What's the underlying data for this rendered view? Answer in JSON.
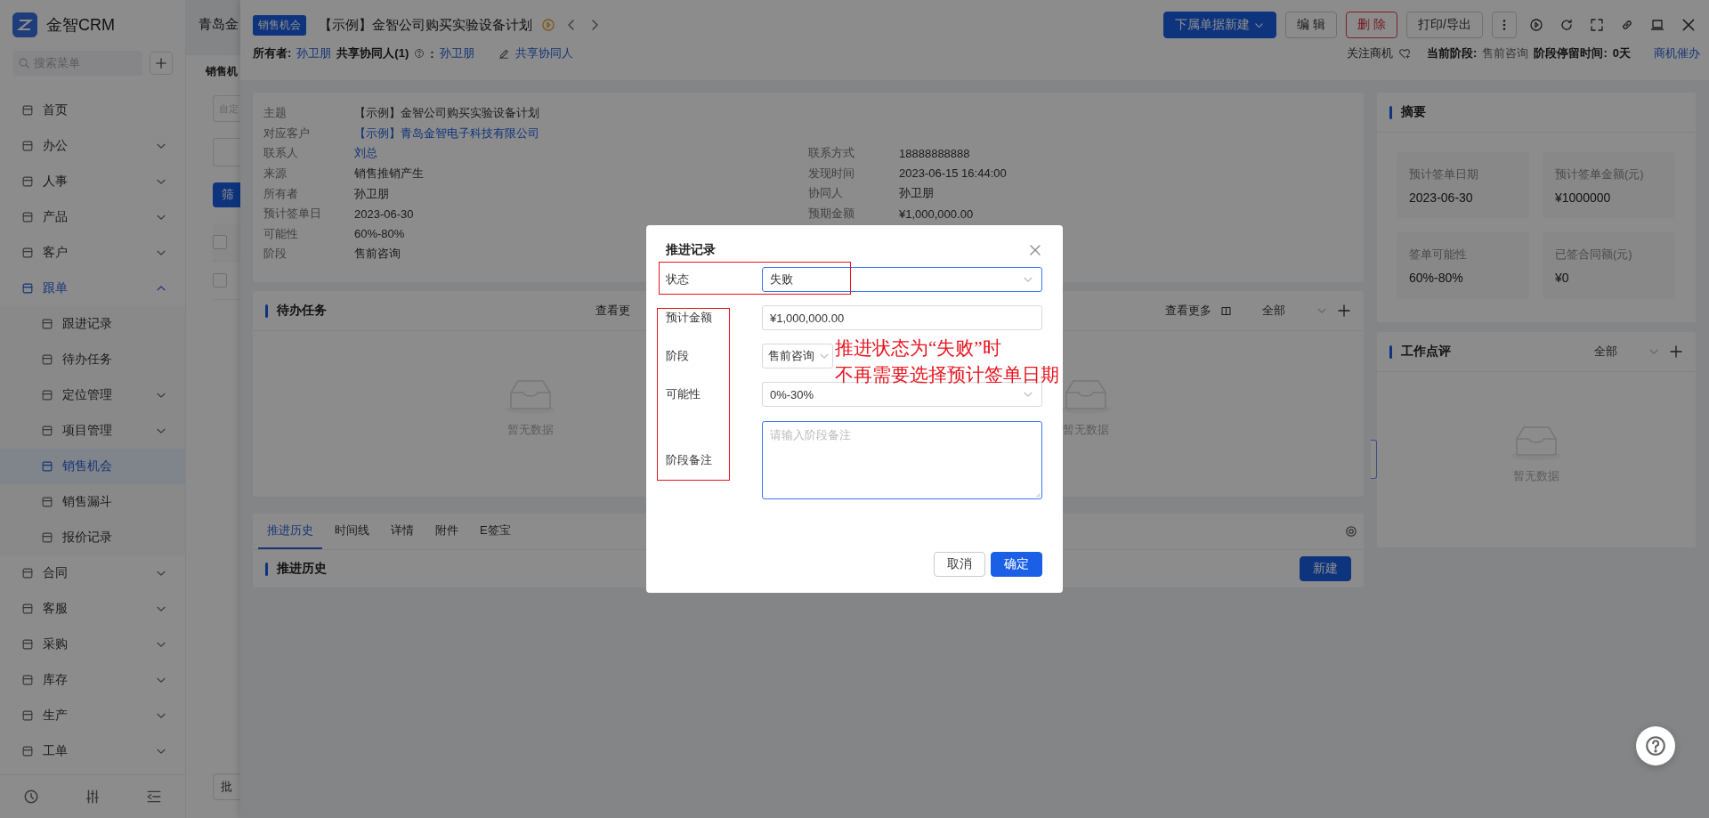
{
  "sidebar": {
    "brand": "金智CRM",
    "search": {
      "placeholder": "搜索菜单"
    },
    "items": [
      {
        "label": "首页",
        "selected": false
      },
      {
        "label": "办公",
        "selected": false,
        "expanded": false
      },
      {
        "label": "人事",
        "selected": false,
        "expanded": false
      },
      {
        "label": "产品",
        "selected": false,
        "expanded": false
      },
      {
        "label": "客户",
        "selected": false,
        "expanded": false
      },
      {
        "label": "跟单",
        "selected": true,
        "expanded": true,
        "children": [
          {
            "label": "跟进记录",
            "selected": false
          },
          {
            "label": "待办任务",
            "selected": false
          },
          {
            "label": "定位管理",
            "selected": false,
            "expanded": false
          },
          {
            "label": "项目管理",
            "selected": false,
            "expanded": false
          },
          {
            "label": "销售机会",
            "selected": true
          },
          {
            "label": "销售漏斗",
            "selected": false
          },
          {
            "label": "报价记录",
            "selected": false
          }
        ]
      },
      {
        "label": "合同",
        "selected": false,
        "expanded": false
      },
      {
        "label": "客服",
        "selected": false,
        "expanded": false
      },
      {
        "label": "采购",
        "selected": false,
        "expanded": false
      },
      {
        "label": "库存",
        "selected": false,
        "expanded": false
      },
      {
        "label": "生产",
        "selected": false,
        "expanded": false
      },
      {
        "label": "工单",
        "selected": false,
        "expanded": false
      }
    ]
  },
  "background_page": {
    "title": "青岛金",
    "tab": "销售机",
    "filter": {
      "placeholder": "自定"
    },
    "filter_button": "筛",
    "rows": [
      {
        "checked": false
      },
      {
        "checked": false
      }
    ],
    "batch_button": "批"
  },
  "record": {
    "tag": "销售机会",
    "title": "【示例】金智公司购买实验设备计划",
    "actions": [
      {
        "label": "下属单据新建",
        "kind": "primary"
      },
      {
        "label": "编 辑",
        "kind": "default"
      },
      {
        "label": "删 除",
        "kind": "danger"
      },
      {
        "label": "打印/导出",
        "kind": "default"
      }
    ],
    "owner": {
      "label": "所有者:",
      "value": "孙卫朋"
    },
    "sharers": {
      "label": "共享协同人(1)",
      "separator": ":",
      "value": "孙卫朋"
    },
    "share_link": "共享协同人",
    "follow": "关注商机",
    "stage": {
      "label": "当前阶段:",
      "value": "售前咨询"
    },
    "stay": {
      "label": "阶段停留时间:",
      "value": "0天"
    },
    "urge_link": "商机催办"
  },
  "details": {
    "left": [
      {
        "label": "主题",
        "value": "【示例】金智公司购买实验设备计划",
        "link": false
      },
      {
        "label": "对应客户",
        "value": "【示例】青岛金智电子科技有限公司",
        "link": true
      },
      {
        "label": "联系人",
        "value": "刘总",
        "link": true
      },
      {
        "label": "来源",
        "value": "销售推销产生",
        "link": false
      },
      {
        "label": "所有者",
        "value": "孙卫朋",
        "link": false
      },
      {
        "label": "预计签单日",
        "value": "2023-06-30",
        "link": false
      },
      {
        "label": "可能性",
        "value": "60%-80%",
        "link": false
      },
      {
        "label": "阶段",
        "value": "售前咨询",
        "link": false
      }
    ],
    "right": [
      {
        "label": "联系方式",
        "value": "18888888888",
        "link": false
      },
      {
        "label": "发现时间",
        "value": "2023-06-15 16:44:00",
        "link": false
      },
      {
        "label": "协同人",
        "value": "孙卫朋",
        "link": false
      },
      {
        "label": "预期金额",
        "value": "¥1,000,000.00",
        "link": false
      }
    ]
  },
  "tasks": {
    "title": "待办任务",
    "more_cut": "查看更",
    "more": "查看更多",
    "filter": "全部",
    "empty_left": "暂无数据",
    "empty_right": "暂无数据"
  },
  "tabs": [
    {
      "label": "推进历史",
      "selected": true
    },
    {
      "label": "时间线",
      "selected": false
    },
    {
      "label": "详情",
      "selected": false
    },
    {
      "label": "附件",
      "selected": false
    },
    {
      "label": "E签宝",
      "selected": false
    }
  ],
  "history": {
    "title": "推进历史",
    "new_button": "新建"
  },
  "summary": {
    "title": "摘要",
    "stats": [
      {
        "label": "预计签单日期",
        "value": "2023-06-30"
      },
      {
        "label": "预计签单金额(元)",
        "value": "¥1000000"
      },
      {
        "label": "签单可能性",
        "value": "60%-80%"
      },
      {
        "label": "已签合同额(元)",
        "value": "¥0"
      }
    ]
  },
  "review": {
    "title": "工作点评",
    "filter": "全部",
    "empty": "暂无数据"
  },
  "modal": {
    "title": "推进记录",
    "fields": [
      {
        "label": "状态",
        "kind": "select",
        "value": "失败",
        "focused": true
      },
      {
        "label": "预计金额",
        "kind": "input",
        "value": "¥1,000,000.00",
        "focused": false
      },
      {
        "label": "阶段",
        "kind": "select",
        "value": "售前咨询",
        "focused": false
      },
      {
        "label": "可能性",
        "kind": "select",
        "value": "0%-30%",
        "focused": false
      },
      {
        "label": "阶段备注",
        "kind": "textarea",
        "placeholder": "请输入阶段备注",
        "focused": true
      }
    ],
    "cancel": "取消",
    "ok": "确定"
  },
  "annotation": {
    "lines": [
      "推进状态为“失败”时",
      "不再需要选择预计签单日期"
    ]
  }
}
